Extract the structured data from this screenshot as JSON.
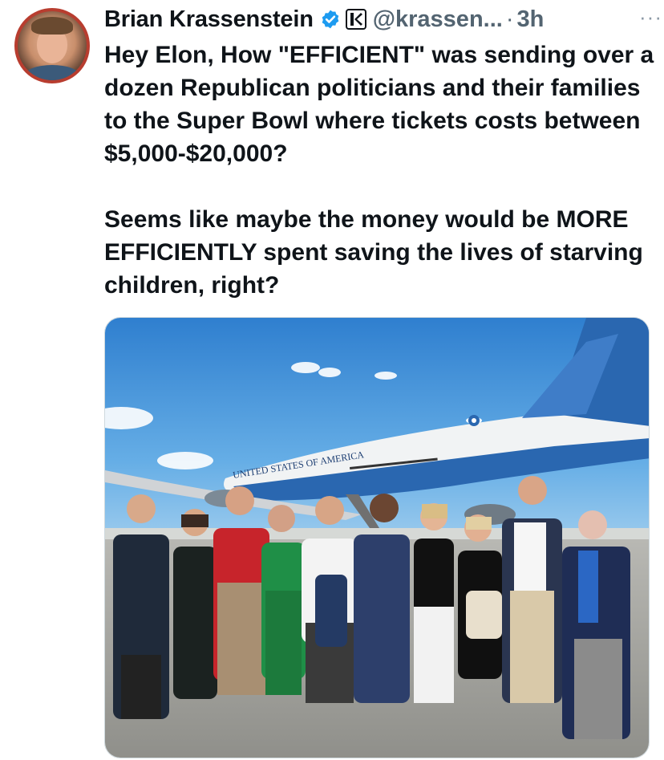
{
  "tweet": {
    "author_name": "Brian Krassenstein",
    "handle": "@krassen...",
    "separator": "·",
    "time": "3h",
    "more_label": "···",
    "text": "Hey Elon, How \"EFFICIENT\" was sending over a dozen Republican politicians and their families to the Super Bowl where tickets costs between $5,000-$20,000?\n\nSeems like maybe the money would be MORE EFFICIENTLY spent saving the lives of starving children, right?"
  },
  "media": {
    "plane_lettering": "UNITED STATES OF AMERICA"
  },
  "colors": {
    "avatar_ring": "#b83d2f",
    "verified_blue": "#1d9bf0",
    "muted_text": "#536471",
    "sky": "#3a8fd6"
  },
  "icons": {
    "verified": "verified-badge-icon",
    "affiliate": "affiliate-k-icon",
    "more": "more-options-icon"
  }
}
